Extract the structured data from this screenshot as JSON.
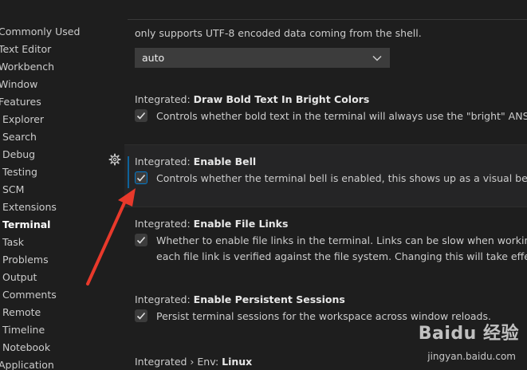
{
  "toc": {
    "items": [
      {
        "label": "Commonly Used",
        "sub": false,
        "active": false
      },
      {
        "label": "Text Editor",
        "sub": false,
        "active": false
      },
      {
        "label": "Workbench",
        "sub": false,
        "active": false
      },
      {
        "label": "Window",
        "sub": false,
        "active": false
      },
      {
        "label": "Features",
        "sub": false,
        "active": false
      },
      {
        "label": "Explorer",
        "sub": true,
        "active": false
      },
      {
        "label": "Search",
        "sub": true,
        "active": false
      },
      {
        "label": "Debug",
        "sub": true,
        "active": false
      },
      {
        "label": "Testing",
        "sub": true,
        "active": false
      },
      {
        "label": "SCM",
        "sub": true,
        "active": false
      },
      {
        "label": "Extensions",
        "sub": true,
        "active": false
      },
      {
        "label": "Terminal",
        "sub": true,
        "active": true
      },
      {
        "label": "Task",
        "sub": true,
        "active": false
      },
      {
        "label": "Problems",
        "sub": true,
        "active": false
      },
      {
        "label": "Output",
        "sub": true,
        "active": false
      },
      {
        "label": "Comments",
        "sub": true,
        "active": false
      },
      {
        "label": "Remote",
        "sub": true,
        "active": false
      },
      {
        "label": "Timeline",
        "sub": true,
        "active": false
      },
      {
        "label": "Notebook",
        "sub": true,
        "active": false
      },
      {
        "label": "Application",
        "sub": false,
        "active": false
      }
    ]
  },
  "settings": {
    "encoding": {
      "desc": "only supports UTF-8 encoded data coming from the shell.",
      "dropdown_value": "auto"
    },
    "bold_bright": {
      "prefix": "Integrated: ",
      "name": "Draw Bold Text In Bright Colors",
      "desc": "Controls whether bold text in the terminal will always use the \"bright\" ANSI color",
      "checked": true
    },
    "enable_bell": {
      "prefix": "Integrated: ",
      "name": "Enable Bell",
      "desc": "Controls whether the terminal bell is enabled, this shows up as a visual bell next to",
      "checked": true
    },
    "file_links": {
      "prefix": "Integrated: ",
      "name": "Enable File Links",
      "desc_line1": "Whether to enable file links in the terminal. Links can be slow when working on a",
      "desc_line2": "each file link is verified against the file system. Changing this will take effect only i",
      "checked": true
    },
    "persistent": {
      "prefix": "Integrated: ",
      "name": "Enable Persistent Sessions",
      "desc": "Persist terminal sessions for the workspace across window reloads.",
      "checked": true
    },
    "env_linux": {
      "prefix": "Integrated › Env: ",
      "name": "Linux"
    }
  },
  "watermark": {
    "logo": "Baidu 经验",
    "url": "jingyan.baidu.com"
  },
  "colors": {
    "accent": "#007acc",
    "arrow": "#e8392b",
    "background": "#1e1e1e"
  },
  "icons": {
    "gear": "gear-icon",
    "check": "check-icon",
    "chevron": "chevron-down-icon"
  }
}
